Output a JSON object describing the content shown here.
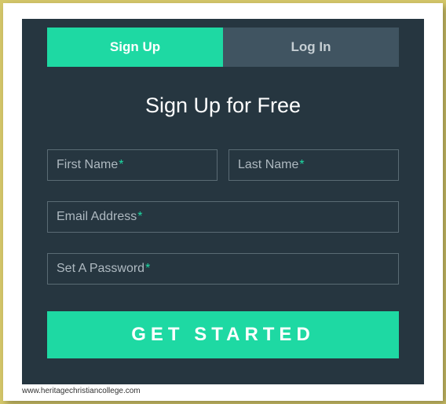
{
  "tabs": {
    "signup": "Sign Up",
    "login": "Log In"
  },
  "title": "Sign Up for Free",
  "fields": {
    "firstName": {
      "label": "First Name",
      "required": "*"
    },
    "lastName": {
      "label": "Last Name",
      "required": "*"
    },
    "email": {
      "label": "Email Address",
      "required": "*"
    },
    "password": {
      "label": "Set A Password",
      "required": "*"
    }
  },
  "submit": "GET STARTED",
  "credit": "www.heritagechristiancollege.com"
}
